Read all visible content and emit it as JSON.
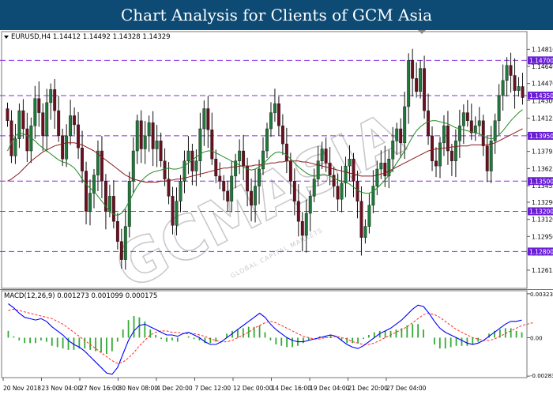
{
  "banner": {
    "title": "Chart Analysis for Clients of GCM Asia"
  },
  "colors": {
    "banner_bg": "#0d4a74",
    "bull": "#1f7a3a",
    "bear": "#6b1020",
    "level_line": "#8a2be2",
    "level_box": "#6a1fd6",
    "ma_fast": "#228b22",
    "ma_slow": "#8b1a1a",
    "macd_line": "#0000ff",
    "signal_line": "#ff2a2a",
    "hist": "#33aa33"
  },
  "watermark": {
    "text": "GCMASIA",
    "subtext": "GLOBAL CAPITAL MARKETS"
  },
  "chart_data": [
    {
      "type": "candlestick",
      "header": "EURUSD,H4 1.14412 1.14492 1.14328 1.14329",
      "ylim": [
        1.1245,
        1.1497
      ],
      "y_ticks": [
        "1.14810",
        "1.14640",
        "1.14470",
        "1.14300",
        "1.14125",
        "1.13960",
        "1.13795",
        "1.13625",
        "1.13455",
        "1.13290",
        "1.13120",
        "1.12950",
        "1.12785",
        "1.12615"
      ],
      "levels": [
        "1.14700",
        "1.14350",
        "1.13950",
        "1.13500",
        "1.13200",
        "1.12800"
      ],
      "x_ticks": [
        "20 Nov 2018",
        "23 Nov 04:00",
        "27 Nov 16:00",
        "30 Nov 08:00",
        "4 Dec 20:00",
        "7 Dec 12:00",
        "12 Dec 00:00",
        "14 Dec 16:00",
        "19 Dec 04:00",
        "21 Dec 20:00",
        "27 Dec 04:00"
      ],
      "closes": [
        1.141,
        1.1375,
        1.1392,
        1.142,
        1.1402,
        1.138,
        1.1405,
        1.1432,
        1.1418,
        1.1395,
        1.1428,
        1.1441,
        1.142,
        1.1395,
        1.1372,
        1.1395,
        1.1415,
        1.1406,
        1.1383,
        1.136,
        1.132,
        1.1338,
        1.1356,
        1.138,
        1.135,
        1.132,
        1.1335,
        1.131,
        1.129,
        1.1272,
        1.1305,
        1.135,
        1.138,
        1.141,
        1.1382,
        1.1395,
        1.1408,
        1.1382,
        1.139,
        1.137,
        1.1352,
        1.1335,
        1.1306,
        1.133,
        1.135,
        1.137,
        1.138,
        1.136,
        1.137,
        1.1402,
        1.1422,
        1.1401,
        1.1372,
        1.1355,
        1.135,
        1.134,
        1.133,
        1.1355,
        1.137,
        1.138,
        1.1365,
        1.134,
        1.1326,
        1.1345,
        1.1362,
        1.138,
        1.1402,
        1.1418,
        1.1427,
        1.1405,
        1.1387,
        1.137,
        1.135,
        1.133,
        1.131,
        1.1296,
        1.1318,
        1.1335,
        1.1352,
        1.137,
        1.1382,
        1.1368,
        1.1356,
        1.1345,
        1.1332,
        1.1348,
        1.1365,
        1.1372,
        1.135,
        1.133,
        1.1294,
        1.1305,
        1.1326,
        1.1345,
        1.1362,
        1.1368,
        1.1355,
        1.1372,
        1.139,
        1.1402,
        1.1388,
        1.1424,
        1.147,
        1.1452,
        1.1439,
        1.1462,
        1.142,
        1.1395,
        1.137,
        1.1365,
        1.1388,
        1.1405,
        1.138,
        1.137,
        1.139,
        1.1405,
        1.1418,
        1.141,
        1.1398,
        1.1405,
        1.141,
        1.1385,
        1.136,
        1.139,
        1.141,
        1.1435,
        1.145,
        1.1465,
        1.1455,
        1.144,
        1.1444,
        1.1433
      ],
      "ma_fast": [
        1.138,
        1.1388,
        1.1395,
        1.1398,
        1.1397,
        1.1395,
        1.1393,
        1.139,
        1.1386,
        1.1383,
        1.138,
        1.1377,
        1.1374,
        1.1371,
        1.1369,
        1.1368,
        1.1366,
        1.1363,
        1.1358,
        1.1352,
        1.1347,
        1.1343,
        1.134,
        1.1335,
        1.133,
        1.1325,
        1.132,
        1.1317,
        1.1316,
        1.1318,
        1.1323,
        1.133,
        1.1338,
        1.1345,
        1.135,
        1.1354,
        1.1357,
        1.1359,
        1.136,
        1.1361,
        1.1362,
        1.1363,
        1.1362,
        1.1362,
        1.1363,
        1.1365,
        1.1368,
        1.1371,
        1.1374,
        1.1377,
        1.1379,
        1.138,
        1.138,
        1.1378,
        1.1376,
        1.1374,
        1.1372,
        1.137,
        1.1368,
        1.1366,
        1.1364,
        1.1362,
        1.1361,
        1.1362,
        1.1364,
        1.1367,
        1.1371,
        1.1375,
        1.1378,
        1.1379,
        1.1378,
        1.1376,
        1.1372,
        1.1368,
        1.1364,
        1.1361,
        1.1358,
        1.1356,
        1.1355,
        1.1355,
        1.1356,
        1.1356,
        1.1355,
        1.1353,
        1.1351,
        1.135,
        1.1349,
        1.1347,
        1.1344,
        1.1341,
        1.1339,
        1.1338,
        1.1338,
        1.134,
        1.1343,
        1.1347,
        1.1351,
        1.1356,
        1.1362,
        1.1368,
        1.1374,
        1.138,
        1.1387,
        1.1394,
        1.14,
        1.1404,
        1.1407,
        1.1409,
        1.141,
        1.141,
        1.1409,
        1.1408,
        1.1407,
        1.1405,
        1.1403,
        1.1402,
        1.1401,
        1.14,
        1.1399,
        1.1398,
        1.1397,
        1.1395,
        1.1393,
        1.1392,
        1.1393,
        1.1396,
        1.14,
        1.1405,
        1.141,
        1.1414,
        1.1418,
        1.1421
      ],
      "ma_slow": [
        1.135,
        1.1352,
        1.1355,
        1.1358,
        1.1362,
        1.1366,
        1.137,
        1.1373,
        1.1376,
        1.1379,
        1.1381,
        1.1383,
        1.1385,
        1.1386,
        1.1387,
        1.1388,
        1.1388,
        1.1388,
        1.1387,
        1.1386,
        1.1384,
        1.1382,
        1.138,
        1.1377,
        1.1374,
        1.1371,
        1.1368,
        1.1365,
        1.1362,
        1.1359,
        1.1356,
        1.1354,
        1.1352,
        1.1351,
        1.135,
        1.1349,
        1.1349,
        1.1349,
        1.1349,
        1.135,
        1.135,
        1.1351,
        1.1351,
        1.1352,
        1.1352,
        1.1353,
        1.1354,
        1.1355,
        1.1356,
        1.1357,
        1.1358,
        1.1359,
        1.136,
        1.1361,
        1.1362,
        1.1363,
        1.1363,
        1.1364,
        1.1364,
        1.1365,
        1.1365,
        1.1365,
        1.1365,
        1.1366,
        1.1366,
        1.1367,
        1.1367,
        1.1368,
        1.1368,
        1.1369,
        1.1369,
        1.137,
        1.137,
        1.137,
        1.137,
        1.1369,
        1.1369,
        1.1368,
        1.1367,
        1.1366,
        1.1365,
        1.1364,
        1.1363,
        1.1362,
        1.1361,
        1.136,
        1.1359,
        1.1358,
        1.1357,
        1.1356,
        1.1355,
        1.1355,
        1.1355,
        1.1355,
        1.1356,
        1.1357,
        1.1358,
        1.136,
        1.1362,
        1.1364,
        1.1366,
        1.1368,
        1.137,
        1.1372,
        1.1374,
        1.1376,
        1.1378,
        1.138,
        1.1381,
        1.1382,
        1.1382,
        1.1383,
        1.1383,
        1.1384,
        1.1384,
        1.1385,
        1.1385,
        1.1385,
        1.1386,
        1.1386,
        1.1386,
        1.1386,
        1.1386,
        1.1387,
        1.1388,
        1.139,
        1.1392,
        1.1394,
        1.1396,
        1.1398,
        1.14,
        1.1402
      ]
    },
    {
      "type": "macd",
      "header": "MACD(12,26,9) 0.001273 0.001099 0.000175",
      "ylim": [
        -0.00283,
        0.00323
      ],
      "y_ticks": [
        "0.003236",
        "0.00",
        "-0.002836"
      ],
      "macd": [
        0.0025,
        0.0022,
        0.0018,
        0.0015,
        0.0014,
        0.0013,
        0.0014,
        0.0012,
        0.0008,
        0.0005,
        0.0002,
        -0.0002,
        -0.0005,
        -0.0007,
        -0.001,
        -0.0014,
        -0.0018,
        -0.0022,
        -0.0026,
        -0.0027,
        -0.0022,
        -0.0012,
        -0.0002,
        0.0005,
        0.0009,
        0.001,
        0.0008,
        0.0006,
        0.0004,
        0.0002,
        0.0002,
        0.0001,
        0.0003,
        0.0004,
        0.0002,
        0.0,
        -0.0003,
        -0.0005,
        -0.0005,
        -0.0003,
        0.0,
        0.0003,
        0.0006,
        0.0009,
        0.0012,
        0.0015,
        0.0018,
        0.0015,
        0.001,
        0.0006,
        0.0003,
        0.0,
        -0.0002,
        -0.0003,
        -0.0003,
        -0.0002,
        -0.0001,
        0.0,
        0.0001,
        0.0002,
        0.0001,
        -0.0002,
        -0.0005,
        -0.0007,
        -0.0008,
        -0.0006,
        -0.0003,
        0.0,
        0.0003,
        0.0005,
        0.0007,
        0.001,
        0.0013,
        0.0017,
        0.0021,
        0.0024,
        0.0023,
        0.0018,
        0.0012,
        0.0007,
        0.0004,
        0.0002,
        0.0,
        -0.0002,
        -0.0004,
        -0.0005,
        -0.0004,
        -0.0002,
        0.0001,
        0.0004,
        0.0007,
        0.001,
        0.0012,
        0.0012,
        0.0013
      ],
      "signal": [
        0.002,
        0.0021,
        0.002,
        0.0019,
        0.0018,
        0.0017,
        0.0016,
        0.0015,
        0.0014,
        0.0012,
        0.001,
        0.0007,
        0.0004,
        0.0001,
        -0.0002,
        -0.0005,
        -0.0008,
        -0.0011,
        -0.0014,
        -0.0017,
        -0.0019,
        -0.0018,
        -0.0015,
        -0.0011,
        -0.0006,
        -0.0002,
        0.0002,
        0.0004,
        0.0005,
        0.0005,
        0.0004,
        0.0004,
        0.0003,
        0.0003,
        0.0003,
        0.0002,
        0.0001,
        -0.0001,
        -0.0002,
        -0.0003,
        -0.0003,
        -0.0002,
        0.0,
        0.0002,
        0.0004,
        0.0007,
        0.0009,
        0.0011,
        0.0012,
        0.0011,
        0.0009,
        0.0007,
        0.0005,
        0.0003,
        0.0001,
        0.0,
        -0.0001,
        -0.0001,
        0.0,
        0.0,
        0.0001,
        0.0,
        -0.0001,
        -0.0003,
        -0.0004,
        -0.0005,
        -0.0005,
        -0.0004,
        -0.0002,
        0.0,
        0.0002,
        0.0004,
        0.0006,
        0.0008,
        0.0011,
        0.0014,
        0.0017,
        0.0018,
        0.0017,
        0.0015,
        0.0012,
        0.0009,
        0.0006,
        0.0004,
        0.0002,
        0.0,
        -0.0001,
        -0.0002,
        -0.0002,
        -0.0001,
        0.0001,
        0.0003,
        0.0005,
        0.0007,
        0.0009,
        0.001,
        0.0011
      ]
    }
  ]
}
